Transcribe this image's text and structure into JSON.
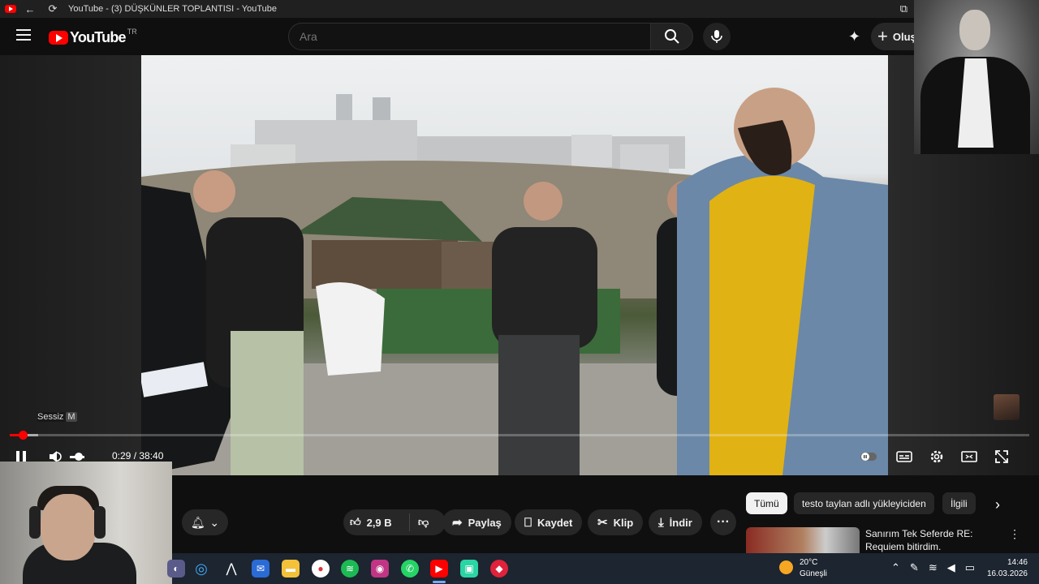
{
  "window": {
    "title": "YouTube - (3) DÜŞKÜNLER TOPLANTISI - YouTube"
  },
  "header": {
    "logo_text": "YouTube",
    "country_code": "TR",
    "search_placeholder": "Ara",
    "create_label": "Oluş"
  },
  "player": {
    "muted_label": "Sessiz",
    "muted_key": "M",
    "current_time": "0:29",
    "duration": "38:40",
    "time_display": "0:29 / 38:40",
    "progress_fraction": 0.0125,
    "volume_level": 0,
    "colors": {
      "progress": "#ff0000"
    }
  },
  "actions": {
    "like_count": "2,9 B",
    "share_label": "Paylaş",
    "save_label": "Kaydet",
    "clip_label": "Klip",
    "download_label": "İndir"
  },
  "chips": [
    {
      "label": "Tümü",
      "active": true
    },
    {
      "label": "testo taylan adlı yükleyiciden",
      "active": false
    },
    {
      "label": "İlgili",
      "active": false
    }
  ],
  "recommendation": {
    "title": "Sanırım Tek Seferde RE: Requiem bitirdim."
  },
  "taskbar": {
    "weather_temp": "20°C",
    "weather_desc": "Güneşli",
    "time": "14:46",
    "date": "16.03.2026"
  }
}
